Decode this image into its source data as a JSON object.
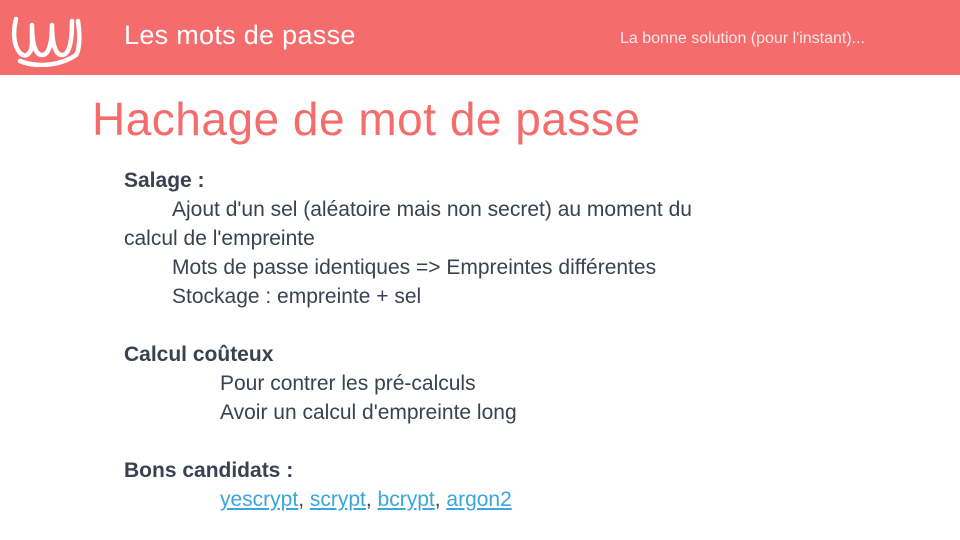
{
  "header": {
    "title": "Les mots de passe",
    "subtitle": "La bonne solution (pour l'instant)..."
  },
  "slide": {
    "title": "Hachage de mot de passe",
    "salage": {
      "heading": "Salage :",
      "line1a": "Ajout d'un sel (aléatoire mais non secret) au moment du",
      "line1b": "calcul de l'empreinte",
      "line2": "Mots de passe identiques => Empreintes différentes",
      "line3": "Stockage : empreinte + sel"
    },
    "calcul": {
      "heading": "Calcul coûteux",
      "line1": "Pour contrer les pré-calculs",
      "line2": "Avoir un calcul d'empreinte long"
    },
    "candidats": {
      "heading": "Bons candidats :",
      "links": [
        "yescrypt",
        "scrypt",
        "bcrypt",
        "argon2"
      ],
      "separator": ", "
    }
  },
  "colors": {
    "accent": "#f56c6c",
    "text": "#3b4150",
    "link": "#3aa6dc"
  },
  "icons": {
    "logo": "wave-logo-icon"
  }
}
